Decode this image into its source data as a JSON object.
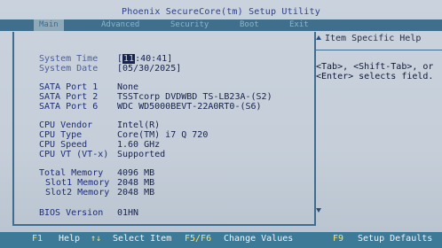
{
  "title": "Phoenix SecureCore(tm) Setup Utility",
  "tabs": [
    "Main",
    "Advanced",
    "Security",
    "Boot",
    "Exit"
  ],
  "help": {
    "title": "Item Specific Help",
    "lines": [
      "<Tab>, <Shift-Tab>, or",
      "<Enter> selects field."
    ]
  },
  "items": [
    {
      "label": "System Time",
      "value_pre": "[",
      "value_cur": "11",
      "value_post": ":40:41]"
    },
    {
      "label": "System Date",
      "value": "[05/30/2025]"
    },
    {
      "label": "SATA Port 1",
      "value": "None"
    },
    {
      "label": "SATA Port 2",
      "value": "TSSTcorp DVDWBD TS-LB23A-(S2)"
    },
    {
      "label": "SATA Port 6",
      "value": "WDC WD5000BEVT-22A0RT0-(S6)"
    },
    {
      "label": "CPU Vendor",
      "value": "Intel(R)"
    },
    {
      "label": "CPU Type",
      "value": "Core(TM) i7 Q 720"
    },
    {
      "label": "CPU Speed",
      "value": "1.60 GHz"
    },
    {
      "label": "CPU VT (VT-x)",
      "value": "Supported"
    },
    {
      "label": "Total Memory",
      "value": "4096 MB"
    },
    {
      "label": "Slot1 Memory",
      "value": "2048 MB"
    },
    {
      "label": "Slot2 Memory",
      "value": "2048 MB"
    },
    {
      "label": "BIOS  Version",
      "value": "01HN"
    }
  ],
  "footer": {
    "f1_key": "F1",
    "f1_label": "Help",
    "nav_key": "↑↓",
    "nav_label": "Select Item",
    "f5_key": "F5/F6",
    "f5_label": "Change Values",
    "f9_key": "F9",
    "f9_label": "Setup Defaults"
  }
}
